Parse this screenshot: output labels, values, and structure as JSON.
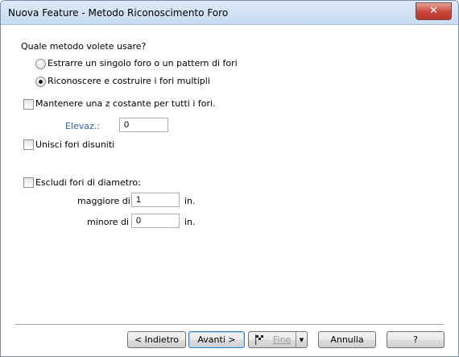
{
  "window": {
    "title": "Nuova Feature - Metodo Riconoscimento Foro",
    "close_symbol": "✕"
  },
  "question": "Quale metodo volete usare?",
  "method_options": [
    {
      "label": "Estrarre un singolo foro o un pattern di fori",
      "checked": false
    },
    {
      "label": "Riconoscere e costruire i fori multipli",
      "checked": true
    }
  ],
  "constant_z": {
    "label": "Mantenere una z costante per tutti i fori.",
    "checked": false
  },
  "elevation": {
    "label": "Elevaz.:",
    "value": "0"
  },
  "merge_holes": {
    "label": "Unisci fori disuniti",
    "checked": false
  },
  "exclude_diameter": {
    "label": "Escludi fori di diametro:",
    "checked": false
  },
  "greater_than": {
    "label": "maggiore di",
    "value": "1",
    "unit": "in."
  },
  "less_than": {
    "label": "minore di",
    "value": "0",
    "unit": "in."
  },
  "buttons": {
    "back": "< Indietro",
    "next": "Avanti >",
    "finish": "Fine",
    "cancel": "Annulla",
    "help": "?"
  },
  "icons": {
    "finish": "checkered-flag-icon",
    "dropdown": "dropdown-arrow-icon",
    "arrow_glyph": "▼"
  }
}
